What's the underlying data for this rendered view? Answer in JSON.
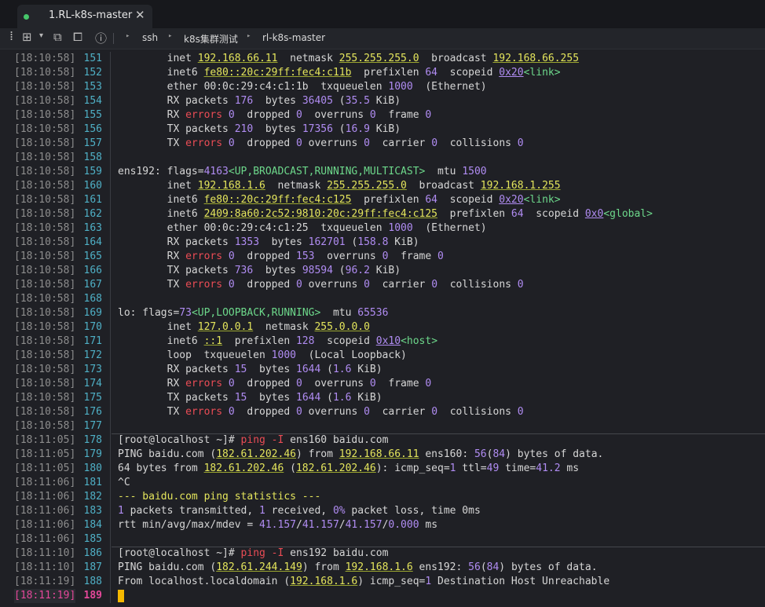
{
  "window": {
    "tab_title": "1.RL-k8s-master",
    "tab_close": "✕"
  },
  "breadcrumb": [
    "ssh",
    "k8s集群测试",
    "rl-k8s-master"
  ],
  "theme": {
    "background": "#1f2025",
    "line_number": "#4fb0c6",
    "highlight": "#e5489a",
    "yellow": "#e4e55c",
    "purple": "#b08cf2",
    "red": "#ea4c55",
    "cursor": "#f5b900"
  },
  "lines": [
    {
      "ts": "[18:10:58]",
      "n": "151",
      "segs": [
        [
          "        inet ",
          ""
        ],
        [
          "192.168.66.11",
          "y"
        ],
        [
          "  netmask ",
          ""
        ],
        [
          "255.255.255.0",
          "y"
        ],
        [
          "  broadcast ",
          ""
        ],
        [
          "192.168.66.255",
          "y"
        ]
      ]
    },
    {
      "ts": "[18:10:58]",
      "n": "152",
      "segs": [
        [
          "        inet6 ",
          ""
        ],
        [
          "fe80::20c:29ff:fec4:c11b",
          "y"
        ],
        [
          "  prefixlen ",
          ""
        ],
        [
          "64",
          "n"
        ],
        [
          "  scopeid ",
          ""
        ],
        [
          "0x20",
          "hx"
        ],
        [
          "<link>",
          "g"
        ]
      ]
    },
    {
      "ts": "[18:10:58]",
      "n": "153",
      "segs": [
        [
          "        ether 00:0c:29:c4:c1:1b  txqueuelen ",
          ""
        ],
        [
          "1000",
          "n"
        ],
        [
          "  (Ethernet)",
          ""
        ]
      ]
    },
    {
      "ts": "[18:10:58]",
      "n": "154",
      "segs": [
        [
          "        RX packets ",
          ""
        ],
        [
          "176",
          "n"
        ],
        [
          "  bytes ",
          ""
        ],
        [
          "36405",
          "n"
        ],
        [
          " (",
          ""
        ],
        [
          "35.5",
          "n"
        ],
        [
          " KiB)",
          ""
        ]
      ]
    },
    {
      "ts": "[18:10:58]",
      "n": "155",
      "segs": [
        [
          "        RX ",
          ""
        ],
        [
          "errors",
          "r"
        ],
        [
          " ",
          ""
        ],
        [
          "0",
          "n"
        ],
        [
          "  dropped ",
          ""
        ],
        [
          "0",
          "n"
        ],
        [
          "  overruns ",
          ""
        ],
        [
          "0",
          "n"
        ],
        [
          "  frame ",
          ""
        ],
        [
          "0",
          "n"
        ]
      ]
    },
    {
      "ts": "[18:10:58]",
      "n": "156",
      "segs": [
        [
          "        TX packets ",
          ""
        ],
        [
          "210",
          "n"
        ],
        [
          "  bytes ",
          ""
        ],
        [
          "17356",
          "n"
        ],
        [
          " (",
          ""
        ],
        [
          "16.9",
          "n"
        ],
        [
          " KiB)",
          ""
        ]
      ]
    },
    {
      "ts": "[18:10:58]",
      "n": "157",
      "segs": [
        [
          "        TX ",
          ""
        ],
        [
          "errors",
          "r"
        ],
        [
          " ",
          ""
        ],
        [
          "0",
          "n"
        ],
        [
          "  dropped ",
          ""
        ],
        [
          "0",
          "n"
        ],
        [
          " overruns ",
          ""
        ],
        [
          "0",
          "n"
        ],
        [
          "  carrier ",
          ""
        ],
        [
          "0",
          "n"
        ],
        [
          "  collisions ",
          ""
        ],
        [
          "0",
          "n"
        ]
      ]
    },
    {
      "ts": "[18:10:58]",
      "n": "158",
      "segs": []
    },
    {
      "ts": "[18:10:58]",
      "n": "159",
      "segs": [
        [
          "ens192: flags=",
          ""
        ],
        [
          "4163",
          "n"
        ],
        [
          "<UP,BROADCAST,RUNNING,MULTICAST>",
          "g"
        ],
        [
          "  mtu ",
          ""
        ],
        [
          "1500",
          "n"
        ]
      ]
    },
    {
      "ts": "[18:10:58]",
      "n": "160",
      "segs": [
        [
          "        inet ",
          ""
        ],
        [
          "192.168.1.6",
          "y"
        ],
        [
          "  netmask ",
          ""
        ],
        [
          "255.255.255.0",
          "y"
        ],
        [
          "  broadcast ",
          ""
        ],
        [
          "192.168.1.255",
          "y"
        ]
      ]
    },
    {
      "ts": "[18:10:58]",
      "n": "161",
      "segs": [
        [
          "        inet6 ",
          ""
        ],
        [
          "fe80::20c:29ff:fec4:c125",
          "y"
        ],
        [
          "  prefixlen ",
          ""
        ],
        [
          "64",
          "n"
        ],
        [
          "  scopeid ",
          ""
        ],
        [
          "0x20",
          "hx"
        ],
        [
          "<link>",
          "g"
        ]
      ]
    },
    {
      "ts": "[18:10:58]",
      "n": "162",
      "segs": [
        [
          "        inet6 ",
          ""
        ],
        [
          "2409:8a60:2c52:9810:20c:29ff:fec4:c125",
          "y"
        ],
        [
          "  prefixlen ",
          ""
        ],
        [
          "64",
          "n"
        ],
        [
          "  scopeid ",
          ""
        ],
        [
          "0x0",
          "hx"
        ],
        [
          "<global>",
          "g"
        ]
      ]
    },
    {
      "ts": "[18:10:58]",
      "n": "163",
      "segs": [
        [
          "        ether 00:0c:29:c4:c1:25  txqueuelen ",
          ""
        ],
        [
          "1000",
          "n"
        ],
        [
          "  (Ethernet)",
          ""
        ]
      ]
    },
    {
      "ts": "[18:10:58]",
      "n": "164",
      "segs": [
        [
          "        RX packets ",
          ""
        ],
        [
          "1353",
          "n"
        ],
        [
          "  bytes ",
          ""
        ],
        [
          "162701",
          "n"
        ],
        [
          " (",
          ""
        ],
        [
          "158.8",
          "n"
        ],
        [
          " KiB)",
          ""
        ]
      ]
    },
    {
      "ts": "[18:10:58]",
      "n": "165",
      "segs": [
        [
          "        RX ",
          ""
        ],
        [
          "errors",
          "r"
        ],
        [
          " ",
          ""
        ],
        [
          "0",
          "n"
        ],
        [
          "  dropped ",
          ""
        ],
        [
          "153",
          "n"
        ],
        [
          "  overruns ",
          ""
        ],
        [
          "0",
          "n"
        ],
        [
          "  frame ",
          ""
        ],
        [
          "0",
          "n"
        ]
      ]
    },
    {
      "ts": "[18:10:58]",
      "n": "166",
      "segs": [
        [
          "        TX packets ",
          ""
        ],
        [
          "736",
          "n"
        ],
        [
          "  bytes ",
          ""
        ],
        [
          "98594",
          "n"
        ],
        [
          " (",
          ""
        ],
        [
          "96.2",
          "n"
        ],
        [
          " KiB)",
          ""
        ]
      ]
    },
    {
      "ts": "[18:10:58]",
      "n": "167",
      "segs": [
        [
          "        TX ",
          ""
        ],
        [
          "errors",
          "r"
        ],
        [
          " ",
          ""
        ],
        [
          "0",
          "n"
        ],
        [
          "  dropped ",
          ""
        ],
        [
          "0",
          "n"
        ],
        [
          " overruns ",
          ""
        ],
        [
          "0",
          "n"
        ],
        [
          "  carrier ",
          ""
        ],
        [
          "0",
          "n"
        ],
        [
          "  collisions ",
          ""
        ],
        [
          "0",
          "n"
        ]
      ]
    },
    {
      "ts": "[18:10:58]",
      "n": "168",
      "segs": []
    },
    {
      "ts": "[18:10:58]",
      "n": "169",
      "segs": [
        [
          "lo: flags=",
          ""
        ],
        [
          "73",
          "n"
        ],
        [
          "<UP,LOOPBACK,RUNNING>",
          "g"
        ],
        [
          "  mtu ",
          ""
        ],
        [
          "65536",
          "n"
        ]
      ]
    },
    {
      "ts": "[18:10:58]",
      "n": "170",
      "segs": [
        [
          "        inet ",
          ""
        ],
        [
          "127.0.0.1",
          "y"
        ],
        [
          "  netmask ",
          ""
        ],
        [
          "255.0.0.0",
          "y"
        ]
      ]
    },
    {
      "ts": "[18:10:58]",
      "n": "171",
      "segs": [
        [
          "        inet6 ",
          ""
        ],
        [
          "::1",
          "y"
        ],
        [
          "  prefixlen ",
          ""
        ],
        [
          "128",
          "n"
        ],
        [
          "  scopeid ",
          ""
        ],
        [
          "0x10",
          "hx"
        ],
        [
          "<host>",
          "g"
        ]
      ]
    },
    {
      "ts": "[18:10:58]",
      "n": "172",
      "segs": [
        [
          "        loop  txqueuelen ",
          ""
        ],
        [
          "1000",
          "n"
        ],
        [
          "  (Local Loopback)",
          ""
        ]
      ]
    },
    {
      "ts": "[18:10:58]",
      "n": "173",
      "segs": [
        [
          "        RX packets ",
          ""
        ],
        [
          "15",
          "n"
        ],
        [
          "  bytes ",
          ""
        ],
        [
          "1644",
          "n"
        ],
        [
          " (",
          ""
        ],
        [
          "1.6",
          "n"
        ],
        [
          " KiB)",
          ""
        ]
      ]
    },
    {
      "ts": "[18:10:58]",
      "n": "174",
      "segs": [
        [
          "        RX ",
          ""
        ],
        [
          "errors",
          "r"
        ],
        [
          " ",
          ""
        ],
        [
          "0",
          "n"
        ],
        [
          "  dropped ",
          ""
        ],
        [
          "0",
          "n"
        ],
        [
          "  overruns ",
          ""
        ],
        [
          "0",
          "n"
        ],
        [
          "  frame ",
          ""
        ],
        [
          "0",
          "n"
        ]
      ]
    },
    {
      "ts": "[18:10:58]",
      "n": "175",
      "segs": [
        [
          "        TX packets ",
          ""
        ],
        [
          "15",
          "n"
        ],
        [
          "  bytes ",
          ""
        ],
        [
          "1644",
          "n"
        ],
        [
          " (",
          ""
        ],
        [
          "1.6",
          "n"
        ],
        [
          " KiB)",
          ""
        ]
      ]
    },
    {
      "ts": "[18:10:58]",
      "n": "176",
      "segs": [
        [
          "        TX ",
          ""
        ],
        [
          "errors",
          "r"
        ],
        [
          " ",
          ""
        ],
        [
          "0",
          "n"
        ],
        [
          "  dropped ",
          ""
        ],
        [
          "0",
          "n"
        ],
        [
          " overruns ",
          ""
        ],
        [
          "0",
          "n"
        ],
        [
          "  carrier ",
          ""
        ],
        [
          "0",
          "n"
        ],
        [
          "  collisions ",
          ""
        ],
        [
          "0",
          "n"
        ]
      ]
    },
    {
      "ts": "[18:10:58]",
      "n": "177",
      "segs": []
    },
    {
      "ts": "[18:11:05]",
      "n": "178",
      "prompt": true,
      "segs": [
        [
          "[root@localhost ~]# ",
          ""
        ],
        [
          "ping -I",
          "r"
        ],
        [
          " ens160 baidu.com",
          ""
        ]
      ]
    },
    {
      "ts": "[18:11:05]",
      "n": "179",
      "segs": [
        [
          "PING baidu.com (",
          ""
        ],
        [
          "182.61.202.46",
          "y"
        ],
        [
          ") from ",
          ""
        ],
        [
          "192.168.66.11",
          "y"
        ],
        [
          " ens160: ",
          ""
        ],
        [
          "56",
          "n"
        ],
        [
          "(",
          ""
        ],
        [
          "84",
          "n"
        ],
        [
          ") bytes of data.",
          ""
        ]
      ]
    },
    {
      "ts": "[18:11:05]",
      "n": "180",
      "segs": [
        [
          "64 bytes from ",
          ""
        ],
        [
          "182.61.202.46",
          "y"
        ],
        [
          " (",
          ""
        ],
        [
          "182.61.202.46",
          "y"
        ],
        [
          "): icmp_seq=",
          ""
        ],
        [
          "1",
          "n"
        ],
        [
          " ttl=",
          ""
        ],
        [
          "49",
          "n"
        ],
        [
          " time=",
          ""
        ],
        [
          "41.2",
          "n"
        ],
        [
          " ms",
          ""
        ]
      ]
    },
    {
      "ts": "[18:11:06]",
      "n": "181",
      "segs": [
        [
          "^C",
          ""
        ]
      ]
    },
    {
      "ts": "[18:11:06]",
      "n": "182",
      "segs": [
        [
          "--- baidu.com ping statistics ---",
          "yp"
        ]
      ]
    },
    {
      "ts": "[18:11:06]",
      "n": "183",
      "segs": [
        [
          "1",
          "n"
        ],
        [
          " packets transmitted, ",
          ""
        ],
        [
          "1",
          "n"
        ],
        [
          " received, ",
          ""
        ],
        [
          "0%",
          "n"
        ],
        [
          " packet loss, time 0ms",
          ""
        ]
      ]
    },
    {
      "ts": "[18:11:06]",
      "n": "184",
      "segs": [
        [
          "rtt min/avg/max/mdev = ",
          ""
        ],
        [
          "41.157",
          "n"
        ],
        [
          "/",
          ""
        ],
        [
          "41.157",
          "n"
        ],
        [
          "/",
          ""
        ],
        [
          "41.157",
          "n"
        ],
        [
          "/",
          ""
        ],
        [
          "0.000",
          "n"
        ],
        [
          " ms",
          ""
        ]
      ]
    },
    {
      "ts": "[18:11:06]",
      "n": "185",
      "segs": []
    },
    {
      "ts": "[18:11:10]",
      "n": "186",
      "prompt": true,
      "segs": [
        [
          "[root@localhost ~]# ",
          ""
        ],
        [
          "ping -I",
          "r"
        ],
        [
          " ens192 baidu.com",
          ""
        ]
      ]
    },
    {
      "ts": "[18:11:10]",
      "n": "187",
      "segs": [
        [
          "PING baidu.com (",
          ""
        ],
        [
          "182.61.244.149",
          "y"
        ],
        [
          ") from ",
          ""
        ],
        [
          "192.168.1.6",
          "y"
        ],
        [
          " ens192: ",
          ""
        ],
        [
          "56",
          "n"
        ],
        [
          "(",
          ""
        ],
        [
          "84",
          "n"
        ],
        [
          ") bytes of data.",
          ""
        ]
      ]
    },
    {
      "ts": "[18:11:19]",
      "n": "188",
      "segs": [
        [
          "From localhost.localdomain (",
          ""
        ],
        [
          "192.168.1.6",
          "y"
        ],
        [
          ") icmp_seq=",
          ""
        ],
        [
          "1",
          "n"
        ],
        [
          " Destination Host Unreachable",
          ""
        ]
      ]
    },
    {
      "ts": "[18:11:19]",
      "n": "189",
      "active": true,
      "segs": []
    }
  ]
}
